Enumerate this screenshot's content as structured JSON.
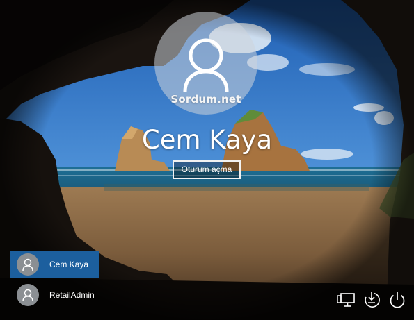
{
  "lock_screen": {
    "watermark": "Sordum.net",
    "selected_user": "Cem Kaya",
    "sign_in_button": "Oturum açma"
  },
  "user_list": [
    {
      "name": "Cem Kaya",
      "selected": true
    },
    {
      "name": "RetailAdmin",
      "selected": false
    }
  ],
  "system_buttons": [
    {
      "icon": "network-icon"
    },
    {
      "icon": "ease-of-access-icon"
    },
    {
      "icon": "power-icon"
    }
  ],
  "colors": {
    "selected_user_bg": "#1c5f9e",
    "avatar_gray": "#8b8f93"
  }
}
